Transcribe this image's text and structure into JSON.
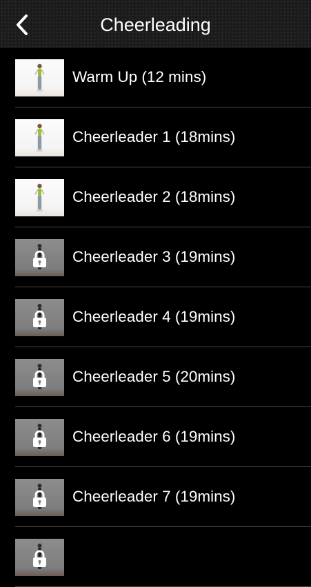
{
  "header": {
    "title": "Cheerleading",
    "back_icon": "chevron-left-icon"
  },
  "workouts": [
    {
      "label": "Warm Up (12 mins)",
      "locked": false
    },
    {
      "label": "Cheerleader 1 (18mins)",
      "locked": false
    },
    {
      "label": "Cheerleader 2 (18mins)",
      "locked": false
    },
    {
      "label": "Cheerleader 3 (19mins)",
      "locked": true
    },
    {
      "label": "Cheerleader 4 (19mins)",
      "locked": true
    },
    {
      "label": "Cheerleader 5 (20mins)",
      "locked": true
    },
    {
      "label": "Cheerleader 6 (19mins)",
      "locked": true
    },
    {
      "label": "Cheerleader 7 (19mins)",
      "locked": true
    },
    {
      "label": "",
      "locked": true
    }
  ],
  "colors": {
    "background": "#000000",
    "nav_bar": "#1b1b1b",
    "separator": "#4a4a4a",
    "text": "#ffffff"
  }
}
